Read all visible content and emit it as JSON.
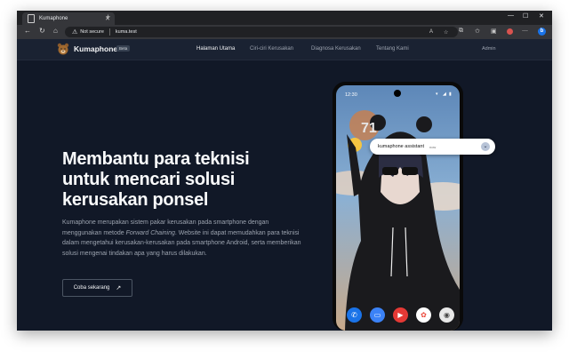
{
  "browser": {
    "tab_title": "Kumaphone",
    "tab_close": "✕",
    "new_tab": "+",
    "minimize": "—",
    "maximize": "☐",
    "close": "✕",
    "security_label": "Not secure",
    "url": "kuma.test"
  },
  "site": {
    "brand": "Kumaphone",
    "badge": "Beta",
    "nav": [
      {
        "label": "Halaman Utama"
      },
      {
        "label": "Ciri-ciri Kerusakan"
      },
      {
        "label": "Diagnosa Kerusakan"
      },
      {
        "label": "Tentang Kami"
      }
    ],
    "admin": "Admin"
  },
  "hero": {
    "title_lines": [
      "Membantu para teknisi",
      "untuk mencari solusi",
      "kerusakan ponsel"
    ],
    "desc_1": "Kumaphone merupakan sistem pakar kerusakan pada smartphone dengan menggunakan metode ",
    "desc_em": "Forward Chaining",
    "desc_2": ". Website ini dapat memudahkan para teknisi dalam mengetahui kerusakan-kerusakan pada smartphone Android, serta memberikan solusi mengenai tindakan apa yang harus dilakukan.",
    "cta": "Coba sekarang",
    "cta_icon": "↗"
  },
  "phone": {
    "time": "12:30",
    "clock_partial": "71",
    "assistant_title": "kumaphone assistant",
    "assistant_time": "now",
    "colors": {
      "accent": "#1a73e8",
      "page_bg": "#111827"
    }
  }
}
